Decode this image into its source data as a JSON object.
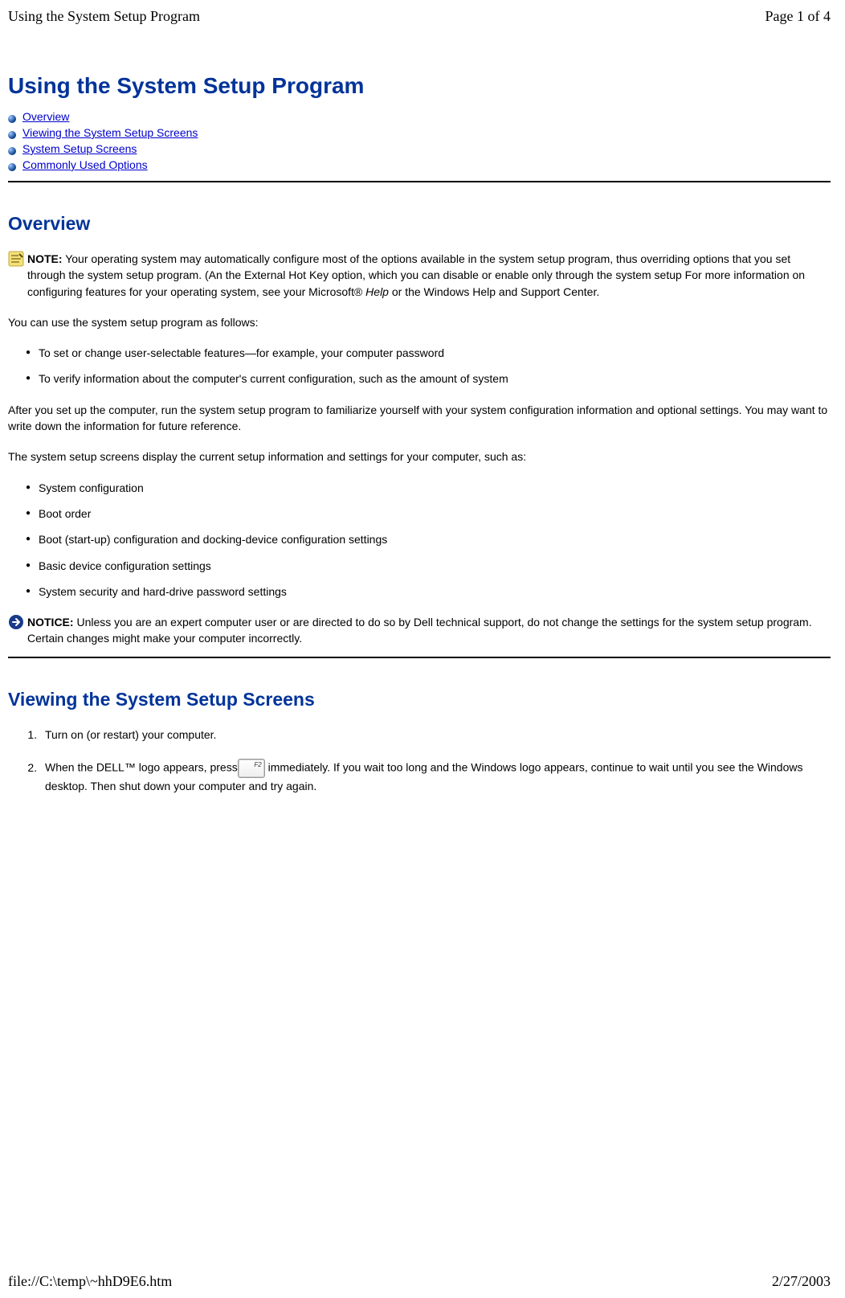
{
  "header": {
    "left": "Using the System Setup Program",
    "right": "Page 1 of 4"
  },
  "title": "Using the System Setup Program",
  "toc": [
    {
      "label": "Overview"
    },
    {
      "label": "Viewing the System Setup Screens"
    },
    {
      "label": "System Setup Screens"
    },
    {
      "label": "Commonly Used Options"
    }
  ],
  "overview": {
    "heading": "Overview",
    "note": {
      "bold": "NOTE:",
      "body": " Your operating system may automatically configure most of the options available in the system setup program, thus overriding options that you set through the system setup program. (An the External Hot Key option, which you can disable or enable only through the system setup For more information on configuring features for your operating system, see your Microsoft® ",
      "italic": "Help",
      "body2": " or the Windows Help and Support Center."
    },
    "para1": "You can use the system setup program as follows:",
    "uses": [
      "To set or change user-selectable features—for example, your computer password",
      "To verify information about the computer's current configuration, such as the amount of system"
    ],
    "para2": "After you set up the computer, run the system setup program to familiarize yourself with your system configuration information and optional settings. You may want to write down the information for future reference.",
    "para3": "The system setup screens display the current setup information and settings for your computer, such as:",
    "screens": [
      "System configuration",
      "Boot order",
      "Boot (start-up) configuration and docking-device configuration settings",
      "Basic device configuration settings",
      "System security and hard-drive password settings"
    ],
    "notice": {
      "bold": "NOTICE:",
      "body": " Unless you are an expert computer user or are directed to do so by Dell technical support, do not change the settings for the system setup program. Certain changes might make your computer incorrectly."
    }
  },
  "viewing": {
    "heading": "Viewing the System Setup Screens",
    "step1": "Turn on (or restart) your computer.",
    "step2_a": "When the DELL™ logo appears, press",
    "key_label": "F2",
    "step2_b": " immediately. If you wait too long and the Windows logo appears, continue to wait until you see the Windows desktop. Then shut down your computer and try again."
  },
  "footer": {
    "left": "file://C:\\temp\\~hhD9E6.htm",
    "right": "2/27/2003"
  },
  "icons": {
    "toc_bullet": "toc-bullet-icon",
    "note": "note-icon",
    "notice": "notice-icon"
  }
}
